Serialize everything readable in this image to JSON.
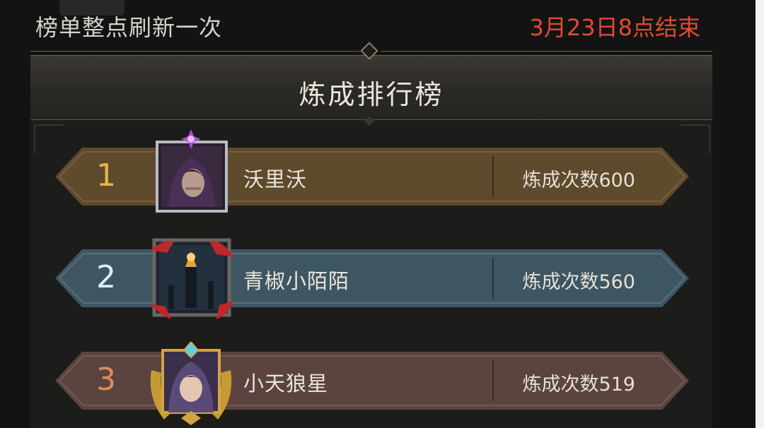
{
  "header": {
    "refresh_note": "榜单整点刷新一次",
    "end_time": "3月23日8点结束",
    "title": "炼成排行榜"
  },
  "leaderboard": {
    "rows": [
      {
        "rank": "1",
        "name": "沃里沃",
        "score": "炼成次数600",
        "rank_color": "#e8b24a",
        "banner_color": "#5e4a2c",
        "frame": "silver-frame",
        "portrait": "hooded-warrior-portrait"
      },
      {
        "rank": "2",
        "name": "青椒小陌陌",
        "score": "炼成次数560",
        "rank_color": "#dfeef2",
        "banner_color": "#3e5662",
        "frame": "red-ribbon-frame",
        "portrait": "torch-pillar-portrait"
      },
      {
        "rank": "3",
        "name": "小天狼星",
        "score": "炼成次数519",
        "rank_color": "#e08a5c",
        "banner_color": "#5b4440",
        "frame": "gold-laurel-frame",
        "portrait": "hooded-girl-portrait"
      }
    ]
  }
}
